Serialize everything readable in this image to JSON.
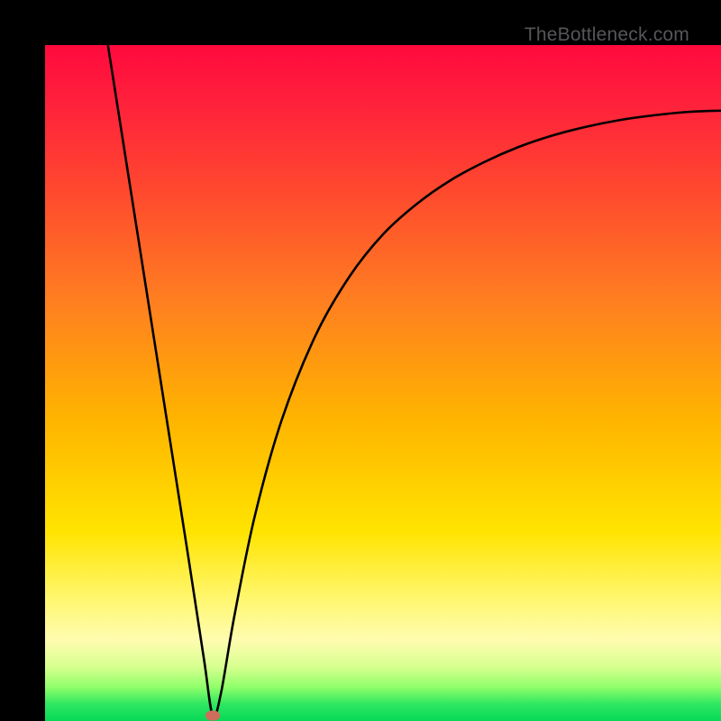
{
  "watermark": "TheBottleneck.com",
  "marker": {
    "x_frac": 0.248,
    "y_frac": 0.992
  },
  "chart_data": {
    "type": "line",
    "title": "",
    "xlabel": "",
    "ylabel": "",
    "xlim": [
      0,
      1
    ],
    "ylim": [
      0,
      1
    ],
    "annotations": [
      "TheBottleneck.com"
    ],
    "series": [
      {
        "name": "curve",
        "x": [
          0.093,
          0.12,
          0.15,
          0.18,
          0.21,
          0.235,
          0.248,
          0.26,
          0.28,
          0.31,
          0.35,
          0.4,
          0.45,
          0.5,
          0.55,
          0.6,
          0.65,
          0.7,
          0.75,
          0.8,
          0.85,
          0.9,
          0.95,
          1.0
        ],
        "y": [
          1.0,
          0.828,
          0.637,
          0.446,
          0.255,
          0.092,
          0.008,
          0.04,
          0.155,
          0.302,
          0.445,
          0.57,
          0.657,
          0.72,
          0.765,
          0.8,
          0.827,
          0.849,
          0.866,
          0.879,
          0.889,
          0.896,
          0.901,
          0.903
        ]
      }
    ],
    "gradient_stops": [
      {
        "pos": 0.0,
        "color": "#ff0a3d"
      },
      {
        "pos": 0.38,
        "color": "#ff7f20"
      },
      {
        "pos": 0.72,
        "color": "#ffe400"
      },
      {
        "pos": 0.92,
        "color": "#d7ff8f"
      },
      {
        "pos": 1.0,
        "color": "#06d957"
      }
    ]
  }
}
